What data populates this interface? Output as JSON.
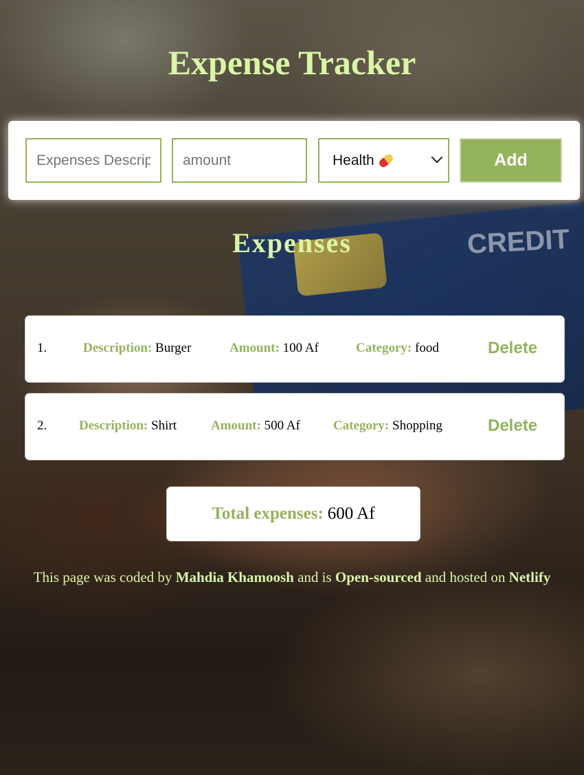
{
  "header": {
    "title": "Expense Tracker"
  },
  "background": {
    "credit_text": "CREDIT"
  },
  "form": {
    "description_placeholder": "Expenses Description",
    "amount_placeholder": "amount",
    "category_selected": "Health",
    "category_icon": "pill-icon",
    "add_label": "Add"
  },
  "list": {
    "heading": "Expenses",
    "description_label": "Description:",
    "amount_label": "Amount:",
    "category_label": "Category:",
    "delete_label": "Delete",
    "items": [
      {
        "index": "1.",
        "description": "Burger",
        "amount": "100 Af",
        "category": "food"
      },
      {
        "index": "2.",
        "description": "Shirt",
        "amount": "500 Af",
        "category": "Shopping"
      }
    ]
  },
  "total": {
    "label": "Total expenses:",
    "value": "600 Af"
  },
  "footer": {
    "t1": "This page was coded by ",
    "author": "Mahdia Khamoosh",
    "t2": " and is ",
    "open_source": "Open-sourced",
    "t3": " and hosted on ",
    "host": "Netlify"
  },
  "colors": {
    "accent": "#94b35c",
    "title": "#dbf5a6"
  }
}
